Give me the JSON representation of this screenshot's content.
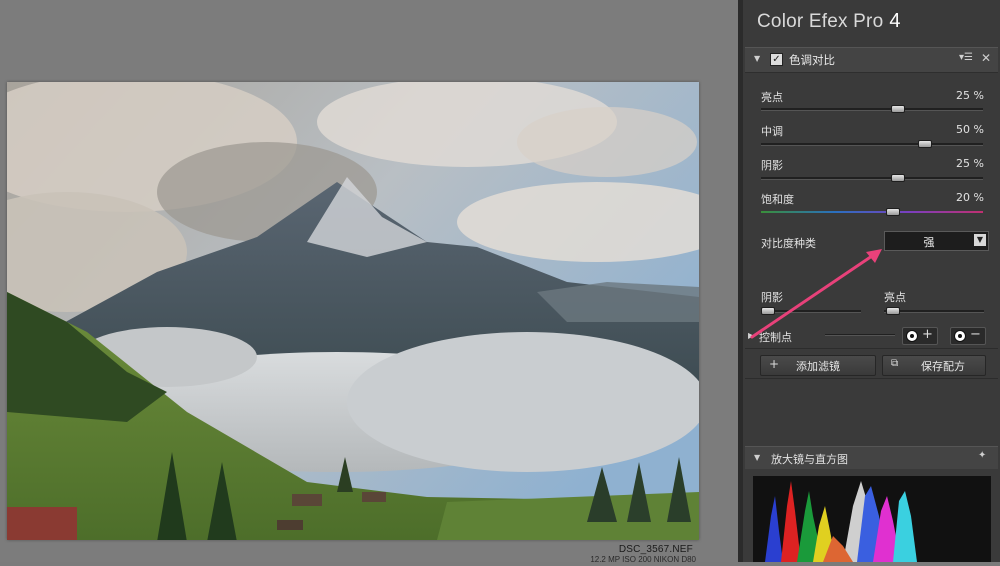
{
  "app": {
    "title": "Color Efex Pro",
    "version": "4"
  },
  "image": {
    "filename": "DSC_3567.NEF",
    "info": "12.2 MP ISO 200 NIKON D80"
  },
  "filter": {
    "name": "色调对比",
    "enabled": true,
    "sliders": [
      {
        "label": "亮点",
        "value": "25 %",
        "level": 0.25
      },
      {
        "label": "中调",
        "value": "50 %",
        "level": 0.5
      },
      {
        "label": "阴影",
        "value": "25 %",
        "level": 0.25
      },
      {
        "label": "饱和度",
        "value": "20 %",
        "level": 0.2
      }
    ],
    "contrast_type": {
      "label": "对比度种类",
      "selected": "强"
    },
    "mini_sliders": [
      {
        "label": "阴影",
        "level": 0.0
      },
      {
        "label": "亮点",
        "level": 0.0
      }
    ],
    "control_points": {
      "label": "控制点"
    }
  },
  "buttons": {
    "add_filter": "添加滤镜",
    "save_recipe": "保存配方"
  },
  "loupe": {
    "title": "放大镜与直方图"
  },
  "colors": {
    "panel": "#3a3a3a",
    "arrow": "#e8417a"
  }
}
